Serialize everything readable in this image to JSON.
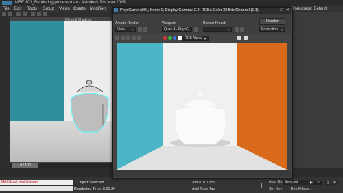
{
  "app": {
    "title": "MBE 101_Rendering process.max - Autodesk 3ds Max 2016",
    "workspace_label": "Workspace: Default",
    "menu": [
      "File",
      "Edit",
      "Tools",
      "Group",
      "Views",
      "Create",
      "Modifiers"
    ],
    "viewport_label": "[Default Shading]",
    "timeline_value": "0 / 100",
    "maxscript_listener": "MAXScript Mini Listener",
    "status_selected": "1 Object Selected",
    "status_rendering": "Rendering Time: 0:01:24",
    "grid": "Grid = 10.0cm",
    "add_time_tag": "Add Time Tag",
    "auto_key": "Auto Key",
    "set_key": "Set Key",
    "selected_dropdown": "Selected",
    "key_filters": "Key Filters...",
    "frame_value": "0"
  },
  "render_frame": {
    "title": "PhysCamera001, frame 0, Display Gamma: 2.2, RGBA Color 32 Bits/Channel (1:1)",
    "area_to_render_label": "Area to Render:",
    "area_to_render_value": "View",
    "viewport_label": "Viewport:",
    "viewport_value": "Quad 4 - PhysCamera001",
    "render_preset_label": "Render Preset:",
    "render_preset_value": "",
    "render_button": "Render",
    "production_value": "Production",
    "channel_value": "RGB Alpha",
    "colors": {
      "teal_wall": "#4cb6c6",
      "orange_wall": "#d96a1c",
      "back_wall": "#f0f0f0"
    }
  }
}
